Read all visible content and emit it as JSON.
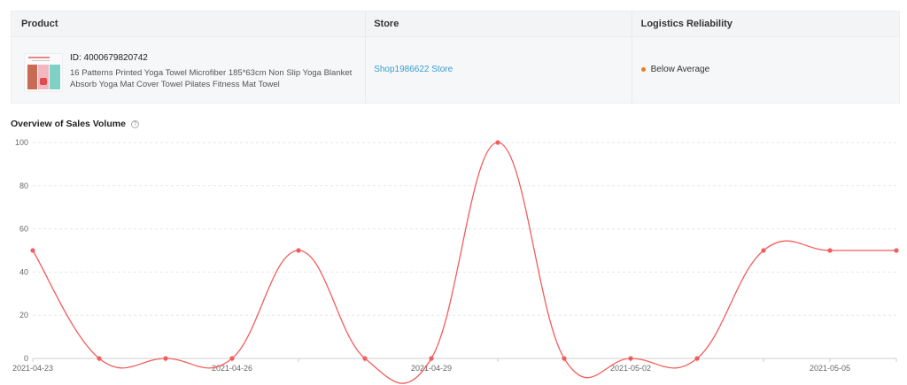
{
  "table": {
    "headers": {
      "product": "Product",
      "store": "Store",
      "logistics": "Logistics Reliability"
    },
    "row": {
      "product_id": "ID: 4000679820742",
      "product_name": "16 Patterns Printed Yoga Towel Microfiber 185*63cm Non Slip Yoga Blanket Absorb Yoga Mat Cover Towel Pilates Fitness Mat Towel",
      "store": "Shop1986622 Store",
      "logistics": "Below Average"
    }
  },
  "section": {
    "title": "Overview of Sales Volume",
    "help_icon": "question-circle-icon"
  },
  "colors": {
    "line": "#f25c5c",
    "logistics_dot": "#f07c1f",
    "link": "#3a9bd0"
  },
  "chart_data": {
    "type": "line",
    "title": "Overview of Sales Volume",
    "x": [
      "2021-04-23",
      "2021-04-24",
      "2021-04-25",
      "2021-04-26",
      "2021-04-27",
      "2021-04-28",
      "2021-04-29",
      "2021-04-30",
      "2021-05-01",
      "2021-05-02",
      "2021-05-03",
      "2021-05-04",
      "2021-05-05",
      "2021-05-06"
    ],
    "series": [
      {
        "values": [
          50,
          0,
          0,
          0,
          50,
          0,
          0,
          100,
          0,
          0,
          0,
          50,
          50,
          50
        ]
      }
    ],
    "x_tick_labels": [
      "2021-04-23",
      "2021-04-26",
      "2021-04-29",
      "2021-05-02",
      "2021-05-05"
    ],
    "y_ticks": [
      0,
      20,
      40,
      60,
      80,
      100
    ],
    "ylim": [
      0,
      100
    ],
    "grid": "horizontal-dashed",
    "smooth": true
  }
}
